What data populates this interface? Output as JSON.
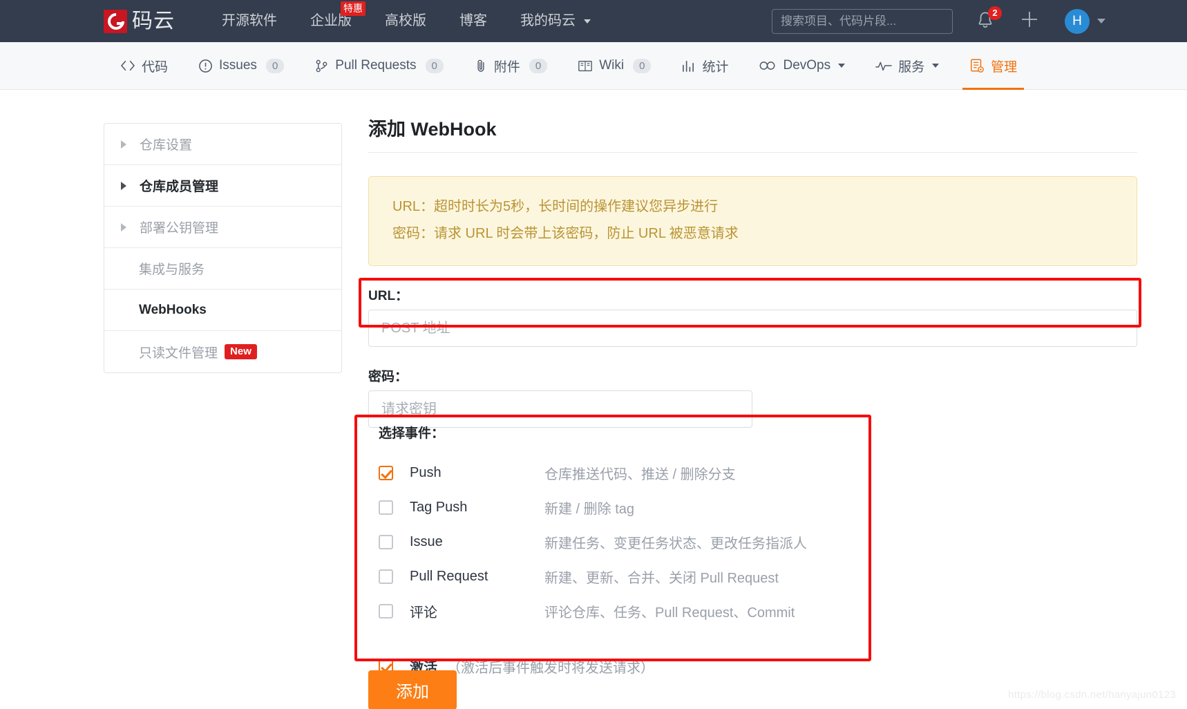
{
  "topbar": {
    "logo_text": "码云",
    "nav": [
      {
        "label": "开源软件",
        "badge": null,
        "caret": false
      },
      {
        "label": "企业版",
        "badge": "特惠",
        "caret": false
      },
      {
        "label": "高校版",
        "badge": null,
        "caret": false
      },
      {
        "label": "博客",
        "badge": null,
        "caret": false
      },
      {
        "label": "我的码云",
        "badge": null,
        "caret": true
      }
    ],
    "search_placeholder": "搜索项目、代码片段...",
    "search_value": "",
    "notification_count": "2",
    "avatar_letter": "H"
  },
  "reponav": [
    {
      "label": "代码",
      "icon": "code-icon",
      "count": null,
      "caret": false,
      "active": false
    },
    {
      "label": "Issues",
      "icon": "issue-icon",
      "count": "0",
      "caret": false,
      "active": false
    },
    {
      "label": "Pull Requests",
      "icon": "pull-request-icon",
      "count": "0",
      "caret": false,
      "active": false
    },
    {
      "label": "附件",
      "icon": "paperclip-icon",
      "count": "0",
      "caret": false,
      "active": false
    },
    {
      "label": "Wiki",
      "icon": "book-icon",
      "count": "0",
      "caret": false,
      "active": false
    },
    {
      "label": "统计",
      "icon": "chart-icon",
      "count": null,
      "caret": false,
      "active": false
    },
    {
      "label": "DevOps",
      "icon": "infinity-icon",
      "count": null,
      "caret": true,
      "active": false
    },
    {
      "label": "服务",
      "icon": "pulse-icon",
      "count": null,
      "caret": true,
      "active": false
    },
    {
      "label": "管理",
      "icon": "settings-list-icon",
      "count": null,
      "caret": false,
      "active": true
    }
  ],
  "sidebar": {
    "items": [
      {
        "label": "仓库设置",
        "arrow": true,
        "bold": false,
        "badge": null
      },
      {
        "label": "仓库成员管理",
        "arrow": true,
        "bold": true,
        "badge": null
      },
      {
        "label": "部署公钥管理",
        "arrow": true,
        "bold": false,
        "badge": null
      },
      {
        "label": "集成与服务",
        "arrow": false,
        "bold": false,
        "badge": null
      },
      {
        "label": "WebHooks",
        "arrow": false,
        "bold": true,
        "badge": null
      },
      {
        "label": "只读文件管理",
        "arrow": false,
        "bold": false,
        "badge": "New"
      }
    ]
  },
  "main": {
    "title": "添加 WebHook",
    "notice_line1": "URL：超时时长为5秒，长时间的操作建议您异步进行",
    "notice_line2": "密码：请求 URL 时会带上该密码，防止 URL 被恶意请求",
    "url_label": "URL：",
    "url_placeholder": "POST 地址",
    "url_value": "",
    "password_label": "密码：",
    "password_placeholder": "请求密钥",
    "password_value": "",
    "events_title": "选择事件：",
    "events": [
      {
        "name": "Push",
        "desc": "仓库推送代码、推送 / 删除分支",
        "checked": true,
        "bold": false
      },
      {
        "name": "Tag Push",
        "desc": "新建 / 删除 tag",
        "checked": false,
        "bold": false
      },
      {
        "name": "Issue",
        "desc": "新建任务、变更任务状态、更改任务指派人",
        "checked": false,
        "bold": false
      },
      {
        "name": "Pull Request",
        "desc": "新建、更新、合并、关闭 Pull Request",
        "checked": false,
        "bold": false
      },
      {
        "name": "评论",
        "desc": "评论仓库、任务、Pull Request、Commit",
        "checked": false,
        "bold": false
      }
    ],
    "activate": {
      "name": "激活",
      "desc": "（激活后事件触发时将发送请求）",
      "checked": true,
      "bold": true
    },
    "submit_label": "添加"
  },
  "watermark": "https://blog.csdn.net/hanyajun0123",
  "colors": {
    "topbar_bg": "#333d4d",
    "accent_orange": "#f2720c",
    "button_orange": "#fd7e14",
    "badge_red": "#e02020",
    "annotation_red": "#f60d0d",
    "notice_bg": "#fdf6df",
    "notice_border": "#f0dfa6",
    "notice_text": "#b89433",
    "avatar_blue": "#2a8bd5"
  }
}
